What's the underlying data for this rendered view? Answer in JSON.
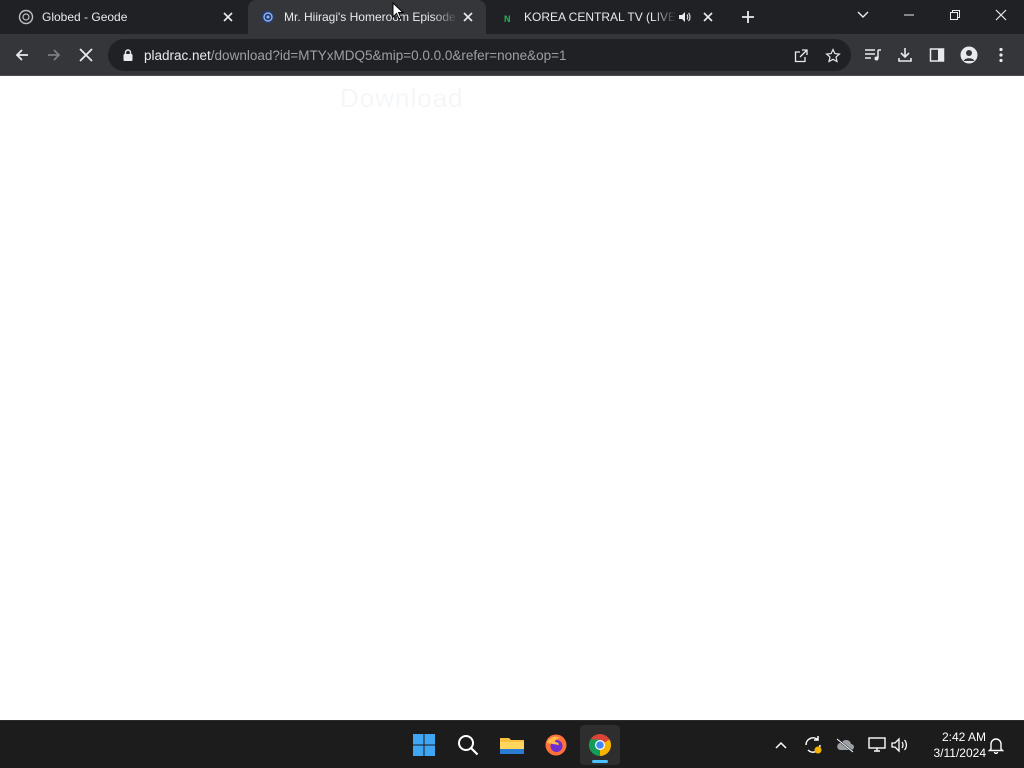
{
  "tabs": [
    {
      "title": "Globed - Geode",
      "favicon": "geode-icon",
      "active": false
    },
    {
      "title": "Mr. Hiiragi's Homeroom Episode",
      "favicon": "site-shield-icon",
      "active": true
    },
    {
      "title": "KOREA CENTRAL TV (LIVESTREAM",
      "favicon": "n-logo-icon",
      "active": false,
      "audio": true
    }
  ],
  "address_bar": {
    "host": "pladrac.net",
    "path": "/download?id=MTYxMDQ5&mip=0.0.0.0&refer=none&op=1"
  },
  "page": {
    "faint_text": "Download"
  },
  "taskbar": {
    "apps": [
      "windows-start-icon",
      "search-icon",
      "file-explorer-icon",
      "firefox-icon",
      "chrome-icon"
    ],
    "clock": {
      "time": "2:42 AM",
      "date": "3/11/2024"
    }
  },
  "colors": {
    "tabstrip": "#202124",
    "toolbar": "#35363a",
    "taskbar": "#1c1c1c",
    "accent": "#4cc2ff"
  }
}
